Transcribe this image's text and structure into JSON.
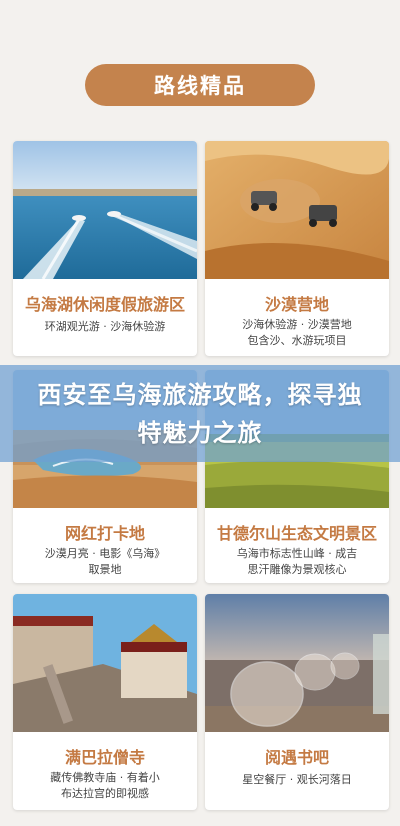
{
  "header": {
    "title": "路线精品"
  },
  "banner": {
    "title": "西安至乌海旅游攻略，探寻独特魅力之旅"
  },
  "cards": [
    {
      "name": "乌海湖休闲度假旅游区",
      "desc": "环湖观光游 · 沙海休验游",
      "photo": "lake-speedboat-photo"
    },
    {
      "name": "沙漠营地",
      "desc": "沙海休验游 · 沙漠营地\n包含沙、水游玩项目",
      "photo": "desert-offroad-photo"
    },
    {
      "name": "网红打卡地",
      "desc": "沙漠月亮 · 电影《乌海》\n取景地",
      "photo": "desert-moon-photo"
    },
    {
      "name": "甘德尔山生态文明景区",
      "desc": "乌海市标志性山峰 · 成吉\n思汗雕像为景观核心",
      "photo": "grassland-photo"
    },
    {
      "name": "满巴拉僧寺",
      "desc": "藏传佛教寺庙 · 有着小\n布达拉宫的即视感",
      "photo": "temple-photo"
    },
    {
      "name": "阅遇书吧",
      "desc": "星空餐厅 · 观长河落日",
      "photo": "dome-restaurant-photo"
    }
  ]
}
